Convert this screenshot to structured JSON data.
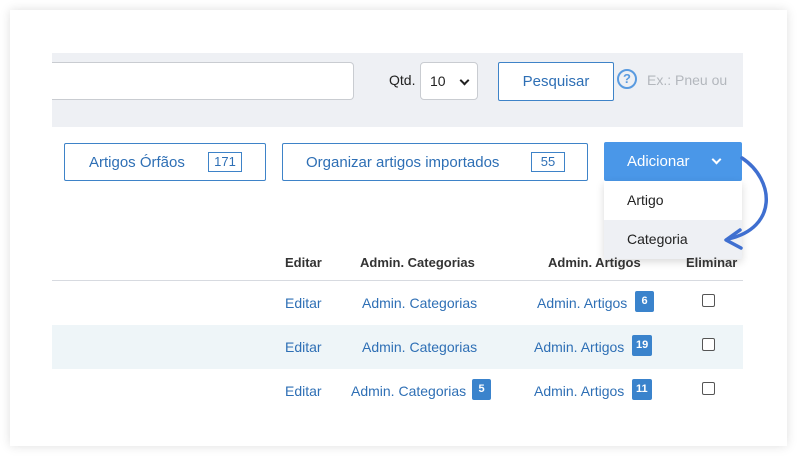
{
  "search": {
    "qtd_label": "Qtd.",
    "qtd_value": "10",
    "submit_label": "Pesquisar",
    "hint": "Ex.: Pneu ou"
  },
  "actions": {
    "orphans_label": "Artigos Órfãos",
    "orphans_count": "171",
    "organize_label": "Organizar artigos importados",
    "organize_count": "55",
    "add_label": "Adicionar",
    "add_menu": [
      "Artigo",
      "Categoria"
    ]
  },
  "table": {
    "headers": [
      "Editar",
      "Admin. Categorias",
      "Admin. Artigos",
      "Eliminar"
    ],
    "rows": [
      {
        "edit": "Editar",
        "categories": "Admin. Categorias",
        "categories_count": "",
        "articles": "Admin. Artigos",
        "articles_count": "6"
      },
      {
        "edit": "Editar",
        "categories": "Admin. Categorias",
        "categories_count": "",
        "articles": "Admin. Artigos",
        "articles_count": "19"
      },
      {
        "edit": "Editar",
        "categories": "Admin. Categorias",
        "categories_count": "5",
        "articles": "Admin. Artigos",
        "articles_count": "11"
      }
    ]
  },
  "colors": {
    "primary": "#4a97e8",
    "link": "#2e6fb5",
    "badge": "#3a83cc",
    "panel": "#eef0f4",
    "row_stripe": "#eef5f8"
  },
  "icons": [
    "help-icon",
    "chevron-down-icon",
    "annotation-arrow-icon"
  ]
}
